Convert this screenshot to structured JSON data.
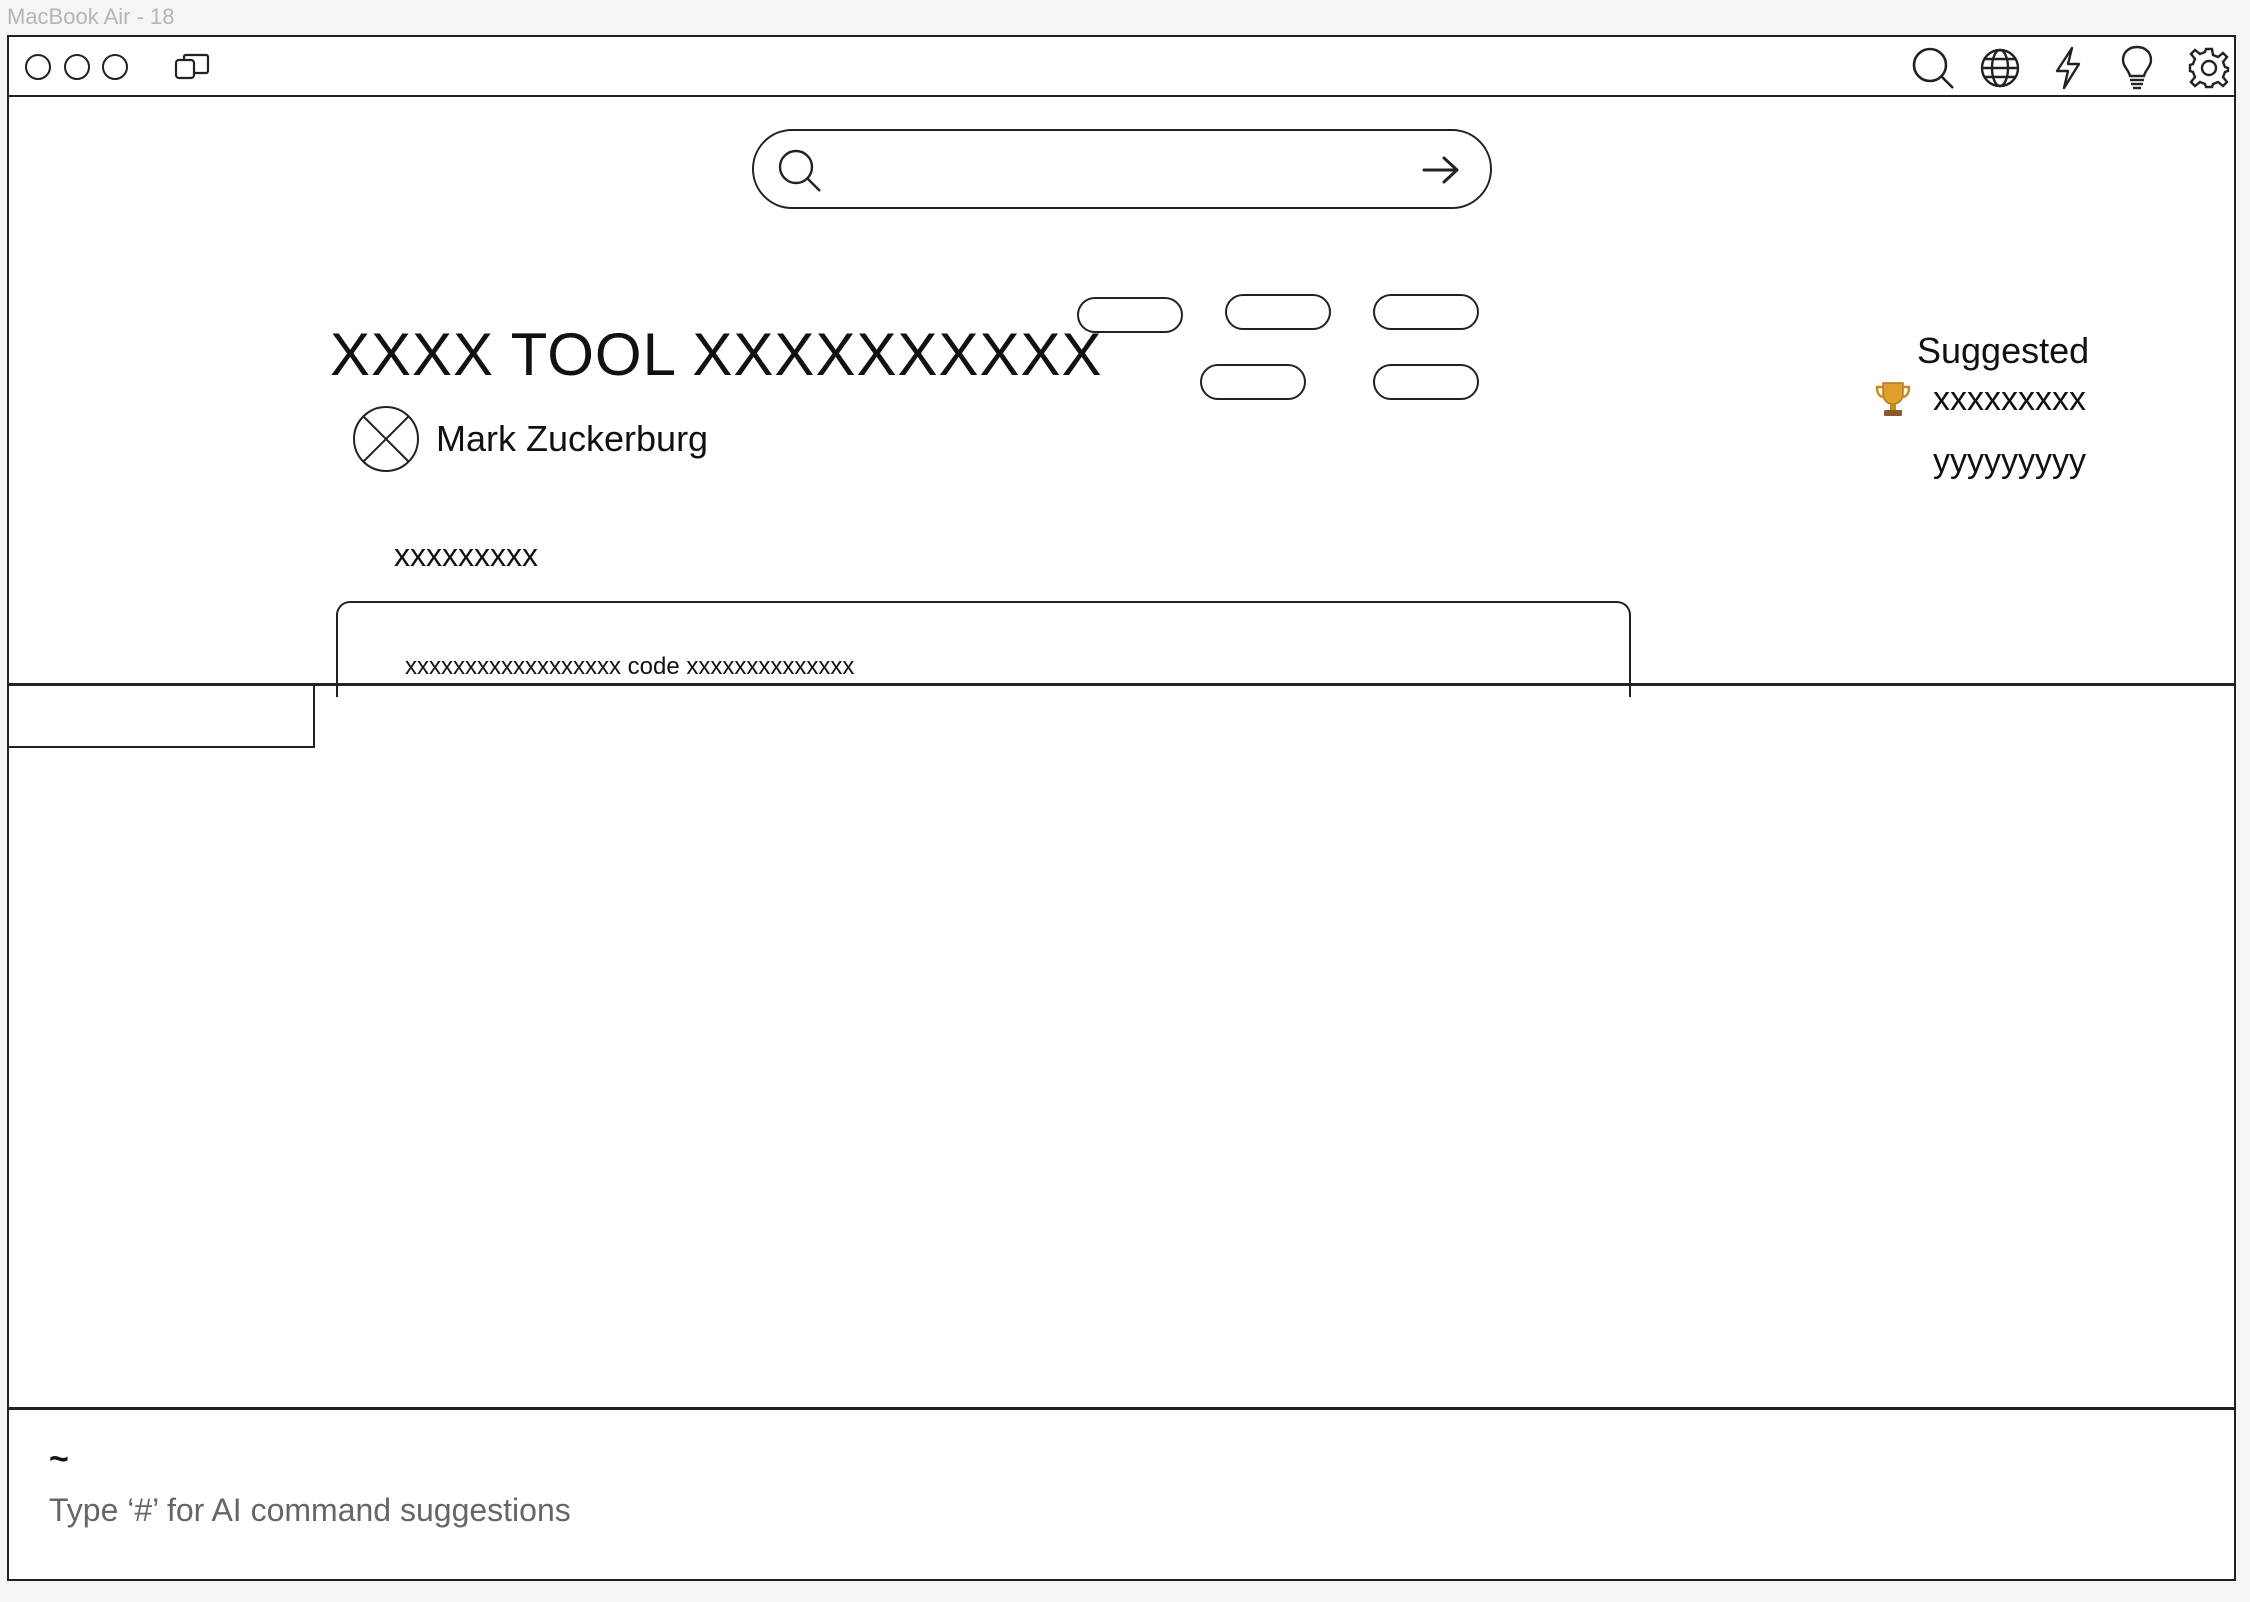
{
  "frame_label": "MacBook Air - 18",
  "titlebar": {
    "traffic_lights": [
      "close",
      "minimize",
      "zoom"
    ],
    "left_icons": [
      "window-copy-icon"
    ],
    "right_icons": [
      "search-icon",
      "globe-icon",
      "lightning-icon",
      "lightbulb-icon",
      "gear-icon"
    ]
  },
  "search": {
    "placeholder": "",
    "value": ""
  },
  "tool": {
    "title": "XXXX TOOL XXXXXXXXXX",
    "author": "Mark Zuckerburg",
    "description": "xxxxxxxxx",
    "tag_pills": [
      "",
      "",
      "",
      "",
      ""
    ]
  },
  "suggested": {
    "title": "Suggested",
    "items": [
      {
        "icon": "trophy-icon",
        "label": "xxxxxxxxx"
      },
      {
        "icon": "",
        "label": "yyyyyyyyy"
      }
    ]
  },
  "tab_card": {
    "code_line": "xxxxxxxxxxxxxxxxxx code xxxxxxxxxxxxxx"
  },
  "terminal": {
    "prompt": "~",
    "hint": "Type ‘#’ for AI command suggestions"
  },
  "colors": {
    "stroke": "#222222",
    "hint_text": "#666666",
    "trophy": "#e0a030"
  }
}
